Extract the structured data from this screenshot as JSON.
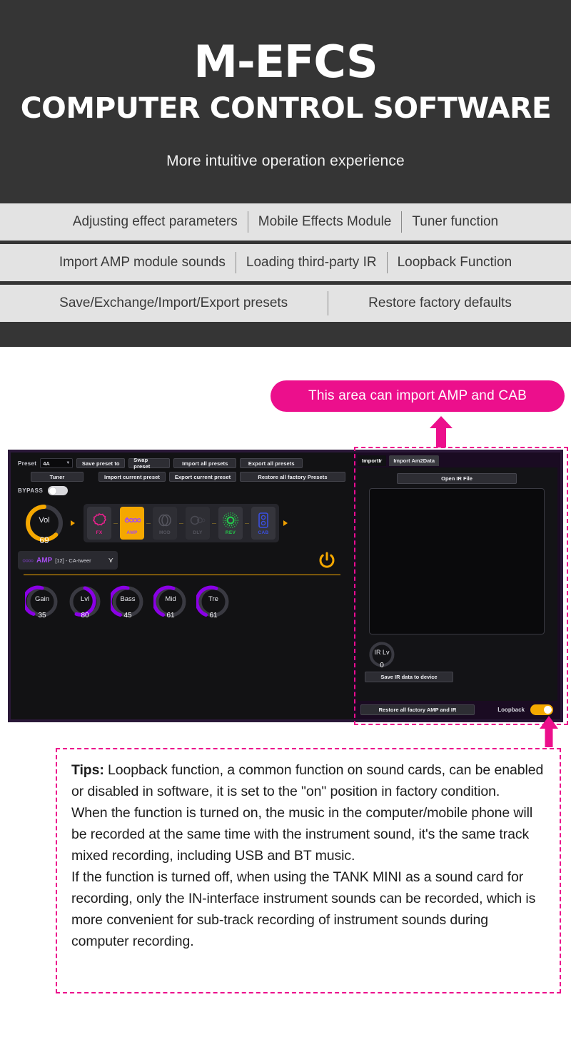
{
  "hero": {
    "title": "M-EFCS",
    "subtitle": "COMPUTER CONTROL SOFTWARE",
    "tagline": "More intuitive operation experience"
  },
  "feature_bands": [
    [
      "Adjusting effect parameters",
      "Mobile Effects Module",
      "Tuner function"
    ],
    [
      "Import AMP module sounds",
      "Loading third-party IR",
      "Loopback Function"
    ],
    [
      "Save/Exchange/Import/Export presets",
      "Restore factory defaults"
    ]
  ],
  "callout": {
    "pill_text": "This area can import AMP and CAB"
  },
  "app": {
    "toolbar": {
      "preset_label": "Preset",
      "preset_value": "4A",
      "save_preset_to": "Save preset to",
      "swap_preset": "Swap preset",
      "import_all_presets": "Import all presets",
      "export_all_presets": "Export all presets",
      "tuner": "Tuner",
      "import_current_preset": "Import current preset",
      "export_current_preset": "Export current preset",
      "restore_all_factory_presets": "Restore all factory Presets",
      "bypass_label": "BYPASS",
      "bypass_state": "off"
    },
    "volume": {
      "label": "Vol",
      "value": "69"
    },
    "chain": [
      {
        "name": "FX",
        "state": "idle",
        "color": "#e8218c"
      },
      {
        "name": "AMP",
        "state": "active",
        "color": "#a64df0"
      },
      {
        "name": "MOD",
        "state": "dim",
        "color": "#55555e"
      },
      {
        "name": "DLY",
        "state": "dim",
        "color": "#55555e"
      },
      {
        "name": "REV",
        "state": "idle",
        "color": "#23c94a"
      },
      {
        "name": "CAB",
        "state": "idle",
        "color": "#3a4fe0"
      }
    ],
    "amp_selector": {
      "tag": "AMP",
      "name": "[12] - CA-tweer",
      "chevron": "chevron-double-down"
    },
    "power": "power-on",
    "param_knobs": [
      {
        "label": "Gain",
        "value": "35"
      },
      {
        "label": "Lvl",
        "value": "80"
      },
      {
        "label": "Bass",
        "value": "45"
      },
      {
        "label": "Mid",
        "value": "61"
      },
      {
        "label": "Tre",
        "value": "61"
      }
    ],
    "right_panel": {
      "tabs": [
        {
          "label": "ImportIr",
          "active": true
        },
        {
          "label": "Import Am2Data",
          "active": false
        }
      ],
      "open_ir_file": "Open IR File",
      "ir_list_items": [],
      "ir_level": {
        "label": "IR Lv",
        "value": "0"
      },
      "save_ir": "Save IR data to device",
      "restore_amp_ir": "Restore all factory AMP and IR",
      "loopback_label": "Loopback",
      "loopback_state": "on"
    }
  },
  "tips": {
    "lead": "Tips:",
    "paragraph1": " Loopback function, a common function on sound cards, can be enabled or disabled in software,  it is set to the \"on\" position in factory condition.",
    "paragraph2": "When the function is turned on, the music in the computer/mobile phone will be recorded at the same time with the instrument sound, it's the same track mixed recording, including USB and BT music.",
    "paragraph3": "If the function is turned off, when using the TANK MINI as a sound card for recording, only the IN-interface instrument sounds can be recorded, which is more convenient for sub-track recording of instrument sounds during computer recording."
  },
  "colors": {
    "accent_pink": "#ec0f8c",
    "accent_orange": "#f5a800",
    "knob_purple": "#8a00e6",
    "header_bg": "#353535",
    "band_bg": "#e3e3e3"
  }
}
